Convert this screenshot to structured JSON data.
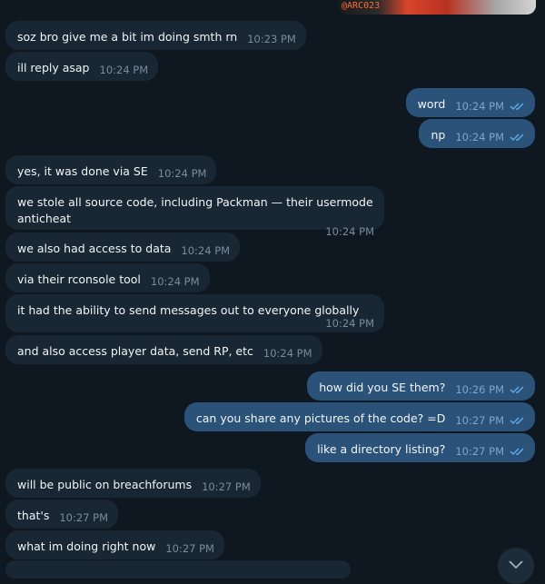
{
  "attachment": {
    "label": "@ARC023"
  },
  "messages": [
    {
      "dir": "in",
      "text": "soz bro give me a bit im doing smth rn",
      "time": "10:23 PM"
    },
    {
      "dir": "in",
      "text": "ill reply asap",
      "time": "10:24 PM"
    },
    {
      "dir": "out",
      "text": "word",
      "time": "10:24 PM"
    },
    {
      "dir": "out",
      "text": "np",
      "time": "10:24 PM"
    },
    {
      "dir": "in",
      "text": "yes, it was done via SE",
      "time": "10:24 PM"
    },
    {
      "dir": "in",
      "text": "we stole all source code, including Packman — their usermode anticheat",
      "time": "10:24 PM"
    },
    {
      "dir": "in",
      "text": "we also had access to data",
      "time": "10:24 PM"
    },
    {
      "dir": "in",
      "text": "via their rconsole tool",
      "time": "10:24 PM"
    },
    {
      "dir": "in",
      "text": "it had the ability to send messages out to everyone globally",
      "time": "10:24 PM"
    },
    {
      "dir": "in",
      "text": "and also access player data, send RP, etc",
      "time": "10:24 PM"
    },
    {
      "dir": "out",
      "text": "how did you SE them?",
      "time": "10:26 PM"
    },
    {
      "dir": "out",
      "text": "can you share any pictures of the code? =D",
      "time": "10:27 PM"
    },
    {
      "dir": "out",
      "text": "like a directory listing?",
      "time": "10:27 PM"
    },
    {
      "dir": "in",
      "text": "will be public on breachforums",
      "time": "10:27 PM"
    },
    {
      "dir": "in",
      "text": "that's",
      "time": "10:27 PM"
    },
    {
      "dir": "in",
      "text": "what im doing right now",
      "time": "10:27 PM"
    }
  ],
  "colors": {
    "background": "#0f1721",
    "incoming_bubble": "#192633",
    "outgoing_bubble": "#2b5278",
    "read_check": "#5fa8e8"
  },
  "icons": {
    "read_receipt": "double-check-icon",
    "scroll_down": "chevron-down-icon"
  }
}
